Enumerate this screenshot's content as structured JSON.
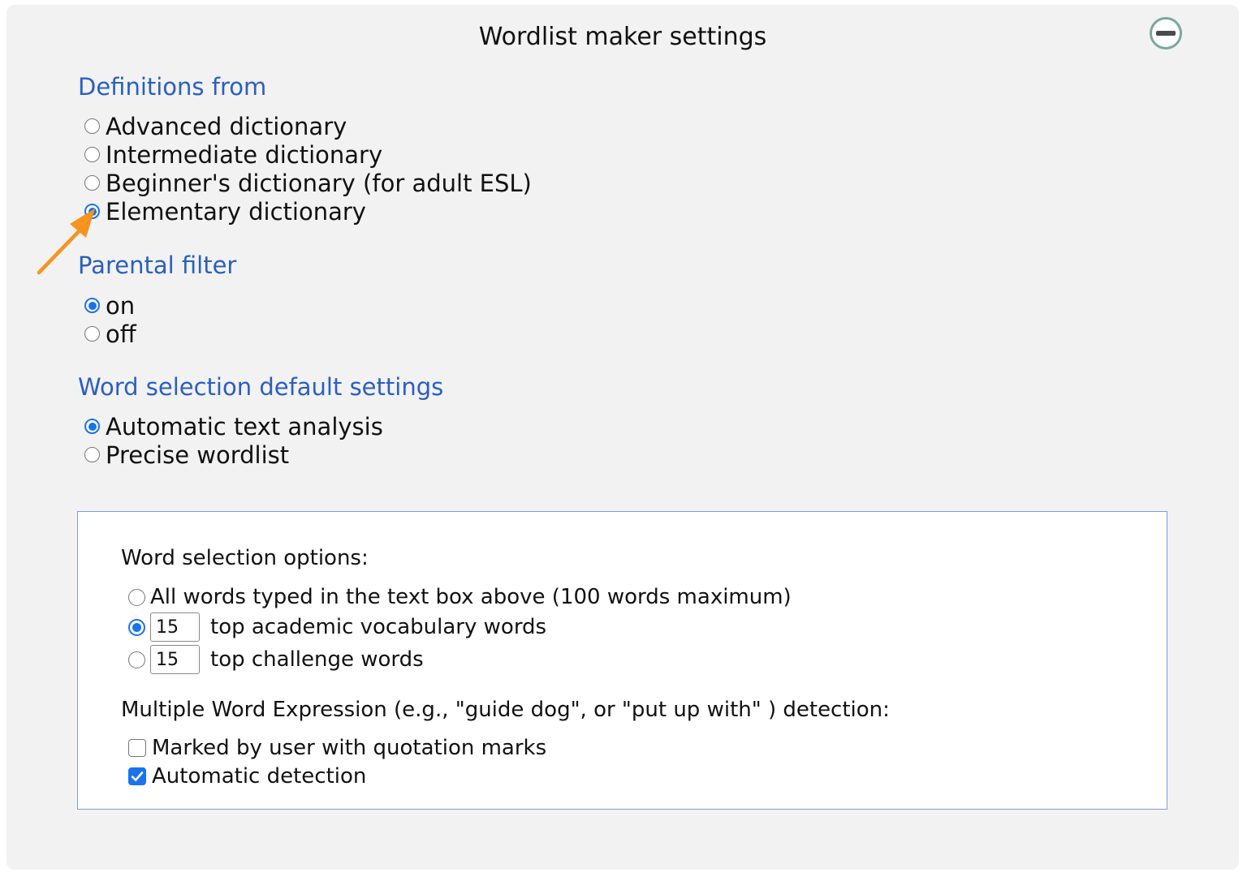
{
  "panel": {
    "title": "Wordlist maker settings",
    "collapse_icon": "minus-circle-icon"
  },
  "definitions": {
    "heading": "Definitions from",
    "options": [
      {
        "label": "Advanced dictionary",
        "checked": false
      },
      {
        "label": "Intermediate dictionary",
        "checked": false
      },
      {
        "label": "Beginner's dictionary (for adult ESL)",
        "checked": false
      },
      {
        "label": "Elementary dictionary",
        "checked": true
      }
    ]
  },
  "parental_filter": {
    "heading": "Parental filter",
    "options": [
      {
        "label": "on",
        "checked": true
      },
      {
        "label": "off",
        "checked": false
      }
    ]
  },
  "word_selection_defaults": {
    "heading": "Word selection default settings",
    "options": [
      {
        "label": "Automatic text analysis",
        "checked": true
      },
      {
        "label": "Precise wordlist",
        "checked": false
      }
    ]
  },
  "word_selection_options": {
    "heading": "Word selection options:",
    "all_words_label": "All words typed in the text box above (100 words maximum)",
    "all_words_checked": false,
    "academic": {
      "value": "15",
      "label": "top academic vocabulary words",
      "checked": true
    },
    "challenge": {
      "value": "15",
      "label": "top challenge words",
      "checked": false
    }
  },
  "mwe_detection": {
    "heading": "Multiple Word Expression (e.g., \"guide dog\", or \"put up with\" ) detection:",
    "options": [
      {
        "label": "Marked by user with quotation marks",
        "checked": false
      },
      {
        "label": "Automatic detection",
        "checked": true
      }
    ]
  },
  "colors": {
    "accent": "#1a73e8",
    "heading": "#2a5fc1",
    "annotation_arrow": "#f7931e",
    "panel_bg": "#f2f2f2"
  }
}
